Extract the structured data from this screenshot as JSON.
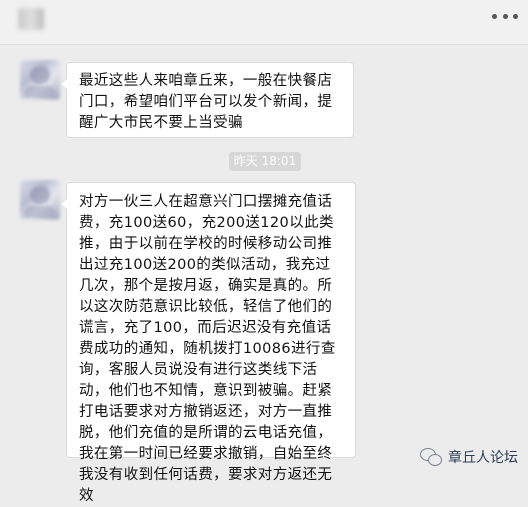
{
  "header": {
    "menu_icon": "more-dots-icon"
  },
  "messages": [
    {
      "text": "最近这些人来咱章丘来，一般在快餐店门口，希望咱们平台可以发个新闻，提醒广大市民不要上当受骗"
    },
    {
      "text": "对方一伙三人在超意兴门口摆摊充值话费，充100送60，充200送120以此类推，由于以前在学校的时候移动公司推出过充100送200的类似活动，我充过几次，那个是按月返，确实是真的。所以这次防范意识比较低，轻信了他们的谎言，充了100，而后迟迟没有充值话费成功的通知，随机拨打10086进行查询，客服人员说没有进行这类线下活动，他们也不知情，意识到被骗。赶紧打电话要求对方撤销返还，对方一直推脱，他们充值的是所谓的云电话充值，我在第一时间已经要求撤销，自始至终我没有收到任何话费，要求对方返还无效"
    }
  ],
  "timestamp": "昨天 18:01",
  "watermark": {
    "icon": "wechat-icon",
    "label": "章丘人论坛"
  }
}
